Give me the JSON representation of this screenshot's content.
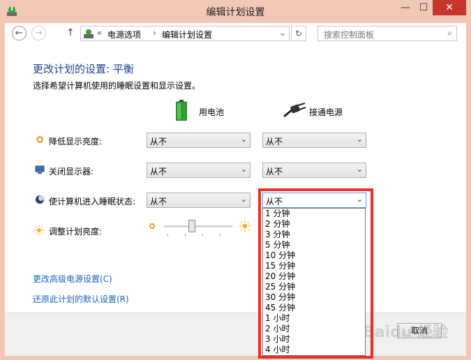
{
  "window": {
    "title": "编辑计划设置",
    "min": "—",
    "max": "☐",
    "close": "✕"
  },
  "nav": {
    "back": "←",
    "forward": "→",
    "up": "↑",
    "breadcrumb_sep": "«",
    "crumb1": "电源选项",
    "crumb_arrow": "›",
    "crumb2": "编辑计划设置",
    "dropdown_arrow": "⌄",
    "refresh": "↻",
    "search_placeholder": "搜索控制面板",
    "search_icon": "⌕"
  },
  "main": {
    "heading": "更改计划的设置: 平衡",
    "subtitle": "选择希望计算机使用的睡眠设置和显示设置。",
    "columns": {
      "battery": "用电池",
      "plugged_in": "接通电源"
    },
    "rows": [
      {
        "label": "降低显示亮度:",
        "battery": "从不",
        "plugged": "从不",
        "icon": "dim-display-icon"
      },
      {
        "label": "关闭显示器:",
        "battery": "从不",
        "plugged": "从不",
        "icon": "display-off-icon"
      },
      {
        "label": "使计算机进入睡眠状态:",
        "battery": "从不",
        "plugged": "从不",
        "icon": "sleep-icon"
      }
    ],
    "brightness_label": "调整计划亮度:",
    "brightness_level": 0.4,
    "chevron": "⌄",
    "links": {
      "advanced": "更改高级电源设置(C)",
      "restore": "还原此计划的默认设置(R)"
    }
  },
  "dropdown_options": [
    "1 分钟",
    "2 分钟",
    "3 分钟",
    "5 分钟",
    "10 分钟",
    "15 分钟",
    "20 分钟",
    "25 分钟",
    "30 分钟",
    "45 分钟",
    "1 小时",
    "2 小时",
    "3 小时",
    "4 小时"
  ],
  "footer": {
    "cancel": "取消"
  },
  "watermark": "Baidu 经验",
  "colors": {
    "accent_border": "#e8302c",
    "heading": "#1c3d8c",
    "link": "#1c63b7",
    "titlebar": "#f2c8b6",
    "close": "#c7362b"
  }
}
